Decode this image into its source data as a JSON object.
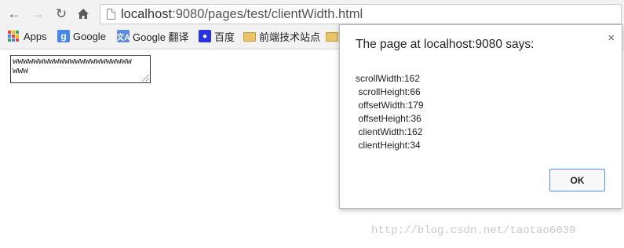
{
  "browser": {
    "url_host": "localhost",
    "url_rest": ":9080/pages/test/clientWidth.html"
  },
  "bookmarks": [
    {
      "label": "Apps",
      "icon": "apps-grid-icon"
    },
    {
      "label": "Google",
      "icon": "google-icon"
    },
    {
      "label": "Google 翻译",
      "icon": "google-translate-icon"
    },
    {
      "label": "百度",
      "icon": "baidu-paw-icon"
    },
    {
      "label": "前端技术站点",
      "icon": "folder-icon"
    },
    {
      "label": "",
      "icon": "folder-icon"
    }
  ],
  "page": {
    "textarea_value": "wwwwwwwwwwwwwwwwwwwwwwwwww"
  },
  "dialog": {
    "title": "The page at localhost:9080 says:",
    "message": "scrollWidth:162\n scrollHeight:66\n offsetWidth:179\n offsetHeight:36\n clientWidth:162\n clientHeight:34",
    "ok_label": "OK",
    "close_glyph": "×"
  },
  "watermark": "http://blog.csdn.net/taotao6039"
}
